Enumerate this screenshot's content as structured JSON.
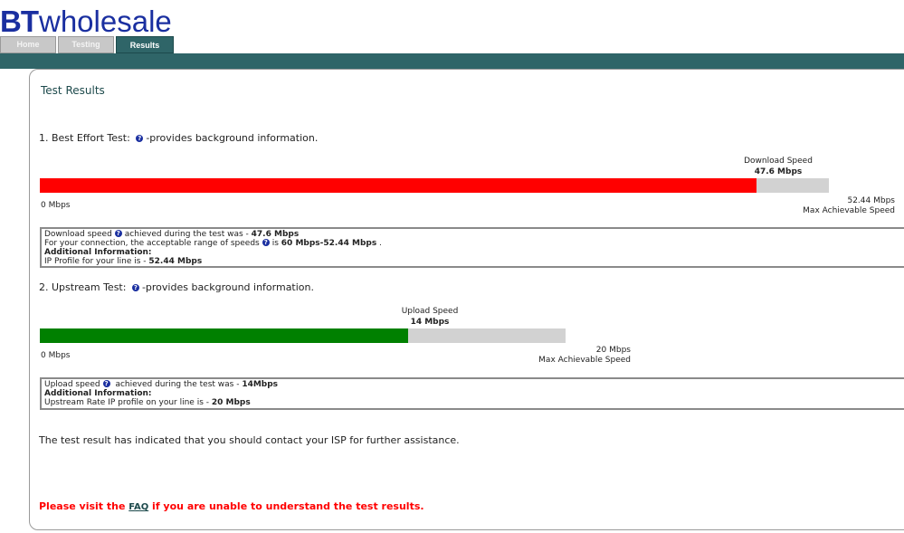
{
  "brand": {
    "bt": "BT",
    "wholesale": "wholesale"
  },
  "tabs": [
    {
      "label": "Home"
    },
    {
      "label": "Testing"
    },
    {
      "label": "Results"
    }
  ],
  "page_title": "Test Results",
  "download": {
    "heading": "1. Best Effort Test:",
    "heading_suffix": "-provides background information.",
    "speed_caption": "Download Speed",
    "speed_value": "47.6 Mbps",
    "fraction": 0.9077,
    "bar_color": "#ff0000",
    "min_label": "0 Mbps",
    "max_value": "52.44 Mbps",
    "max_caption": "Max Achievable Speed",
    "info": {
      "line1_pre": "Download speed",
      "line1_mid": "achieved during the test was - ",
      "line1_val": "47.6 Mbps",
      "line2_pre": "For your connection, the acceptable range of speeds",
      "line2_mid": "is ",
      "line2_val": "60 Mbps-52.44 Mbps",
      "line2_end": " .",
      "additional": "Additional Information:",
      "line3_pre": "IP Profile for your line is - ",
      "line3_val": "52.44 Mbps"
    }
  },
  "upload": {
    "heading": "2. Upstream Test:",
    "heading_suffix": "-provides background information.",
    "speed_caption": "Upload Speed",
    "speed_value": "14 Mbps",
    "fraction": 0.7,
    "bar_color": "#008000",
    "min_label": "0 Mbps",
    "max_value": "20 Mbps",
    "max_caption": "Max Achievable Speed",
    "info": {
      "line1_pre": "Upload speed",
      "line1_mid": " achieved during the test was - ",
      "line1_val": "14Mbps",
      "additional": "Additional Information:",
      "line2_pre": "Upstream Rate IP profile on your line is - ",
      "line2_val": "20 Mbps"
    }
  },
  "result_message": "The test result has indicated that you should contact your ISP for further assistance.",
  "faq_note": {
    "pre": "Please visit the ",
    "link": "FAQ",
    "post": " if you are unable to understand the test results."
  },
  "icons": {
    "help": "help-icon"
  }
}
